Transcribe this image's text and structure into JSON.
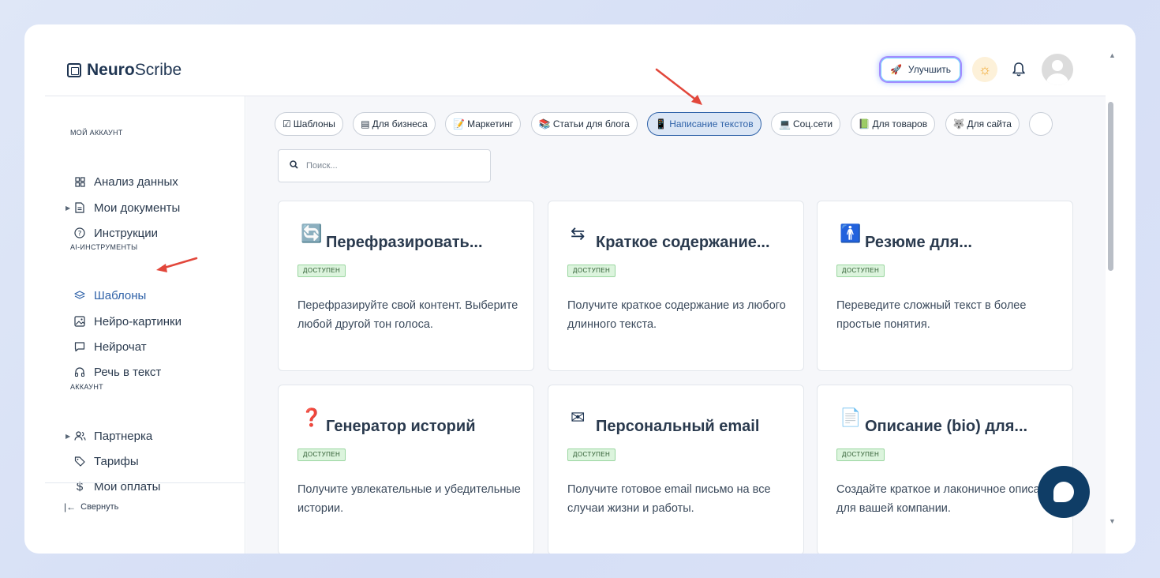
{
  "header": {
    "logo_bold": "Neuro",
    "logo_rest": "Scribe",
    "upgrade_label": "Улучшить"
  },
  "sidebar": {
    "sections": [
      {
        "title": "МОЙ АККАУНТ"
      },
      {
        "title": "AI-ИНСТРУМЕНТЫ"
      },
      {
        "title": "АККАУНТ"
      }
    ],
    "items": [
      {
        "label": "Анализ данных",
        "icon": "grid-icon"
      },
      {
        "label": "Мои документы",
        "icon": "document-icon"
      },
      {
        "label": "Инструкции",
        "icon": "help-circle-icon"
      },
      {
        "label": "Шаблоны",
        "icon": "layers-icon",
        "active": true
      },
      {
        "label": "Нейро-картинки",
        "icon": "image-icon"
      },
      {
        "label": "Нейрочат",
        "icon": "chat-icon"
      },
      {
        "label": "Речь в текст",
        "icon": "headphones-icon"
      },
      {
        "label": "Партнерка",
        "icon": "users-icon"
      },
      {
        "label": "Тарифы",
        "icon": "tag-icon"
      },
      {
        "label": "Мои оплаты",
        "icon": "dollar-icon"
      }
    ],
    "collapse_label": "Свернуть"
  },
  "tabs": [
    {
      "label": "Шаблоны",
      "icon": "☑"
    },
    {
      "label": "Для бизнеса",
      "icon": "▤"
    },
    {
      "label": "Маркетинг",
      "icon": "📝"
    },
    {
      "label": "Статьи для блога",
      "icon": "📚"
    },
    {
      "label": "Написание текстов",
      "icon": "📱",
      "active": true
    },
    {
      "label": "Соц.сети",
      "icon": "💻"
    },
    {
      "label": "Для товаров",
      "icon": "📗"
    },
    {
      "label": "Для сайта",
      "icon": "🐺"
    }
  ],
  "search": {
    "placeholder": "Поиск..."
  },
  "cards": [
    {
      "icon": "🔄",
      "title": "Перефразировать...",
      "badge": "ДОСТУПЕН",
      "desc": "Перефразируйте свой контент. Выберите любой другой тон голоса."
    },
    {
      "icon": "⇆",
      "title": "Краткое содержание...",
      "badge": "ДОСТУПЕН",
      "desc": "Получите краткое содержание из любого длинного текста."
    },
    {
      "icon": "🚹",
      "title": "Резюме для...",
      "badge": "ДОСТУПЕН",
      "desc": "Переведите сложный текст в более простые понятия."
    },
    {
      "icon": "❓",
      "title": "Генератор историй",
      "badge": "ДОСТУПЕН",
      "desc": "Получите увлекательные и убедительные истории."
    },
    {
      "icon": "✉",
      "title": "Персональный email",
      "badge": "ДОСТУПЕН",
      "desc": "Получите готовое email письмо на все случаи жизни и работы."
    },
    {
      "icon": "📄",
      "title": "Описание (bio) для...",
      "badge": "ДОСТУПЕН",
      "desc": "Создайте краткое и лаконичное описание для вашей компании."
    }
  ],
  "colors": {
    "accent": "#2f62a8",
    "annotation_arrow": "#e2473b",
    "chat_bubble": "#0f3d66"
  }
}
